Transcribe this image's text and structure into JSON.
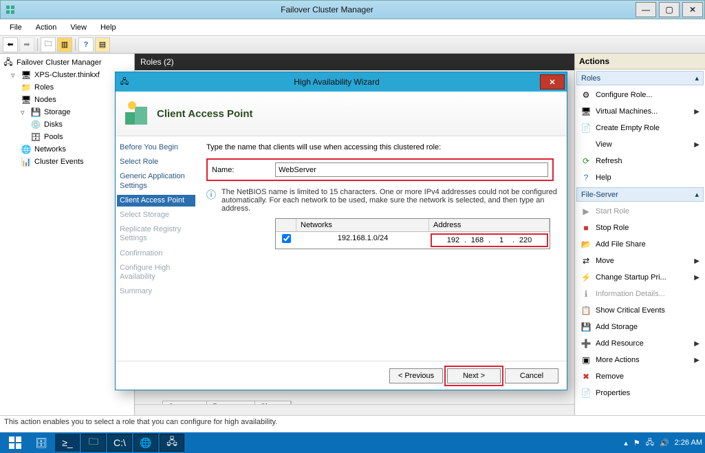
{
  "window": {
    "title": "Failover Cluster Manager",
    "menus": [
      "File",
      "Action",
      "View",
      "Help"
    ]
  },
  "tree": {
    "root": "Failover Cluster Manager",
    "cluster": "XPS-Cluster.thinkxf",
    "items": [
      "Roles",
      "Nodes",
      "Storage",
      "Disks",
      "Pools",
      "Networks",
      "Cluster Events"
    ]
  },
  "center": {
    "header": "Roles (2)",
    "tabs": [
      "Summary",
      "Resources",
      "Shares"
    ]
  },
  "wizard": {
    "title": "High Availability Wizard",
    "heading": "Client Access Point",
    "nav": {
      "before": "Before You Begin",
      "select": "Select Role",
      "generic": "Generic Application Settings",
      "cap": "Client Access Point",
      "storage": "Select Storage",
      "replicate": "Replicate Registry Settings",
      "confirm": "Confirmation",
      "conf_ha": "Configure High Availability",
      "summary": "Summary"
    },
    "instr": "Type the name that clients will use when accessing this clustered role:",
    "name_label": "Name:",
    "name_value": "WebServer",
    "info": "The NetBIOS name is limited to 15 characters. One or more IPv4 addresses could not be configured automatically. For each network to be used, make sure the network is selected, and then type an address.",
    "net_header_networks": "Networks",
    "net_header_address": "Address",
    "net_row_network": "192.168.1.0/24",
    "addr": {
      "o1": "192",
      "o2": "168",
      "o3": "1",
      "o4": "220"
    },
    "btn_prev": "< Previous",
    "btn_next": "Next >",
    "btn_cancel": "Cancel"
  },
  "actions": {
    "header": "Actions",
    "section_roles": "Roles",
    "roles_items": {
      "configure": "Configure Role...",
      "vm": "Virtual Machines...",
      "empty": "Create Empty Role",
      "view": "View",
      "refresh": "Refresh",
      "help": "Help"
    },
    "section_fs": "File-Server",
    "fs_items": {
      "start": "Start Role",
      "stop": "Stop Role",
      "addshare": "Add File Share",
      "move": "Move",
      "startup": "Change Startup Pri...",
      "info": "Information Details...",
      "critical": "Show Critical Events",
      "addstorage": "Add Storage",
      "addresource": "Add Resource",
      "more": "More Actions",
      "remove": "Remove",
      "props": "Properties"
    }
  },
  "status": "This action enables you to select a role that you can configure for high availability.",
  "taskbar": {
    "time": "2:26 AM"
  }
}
